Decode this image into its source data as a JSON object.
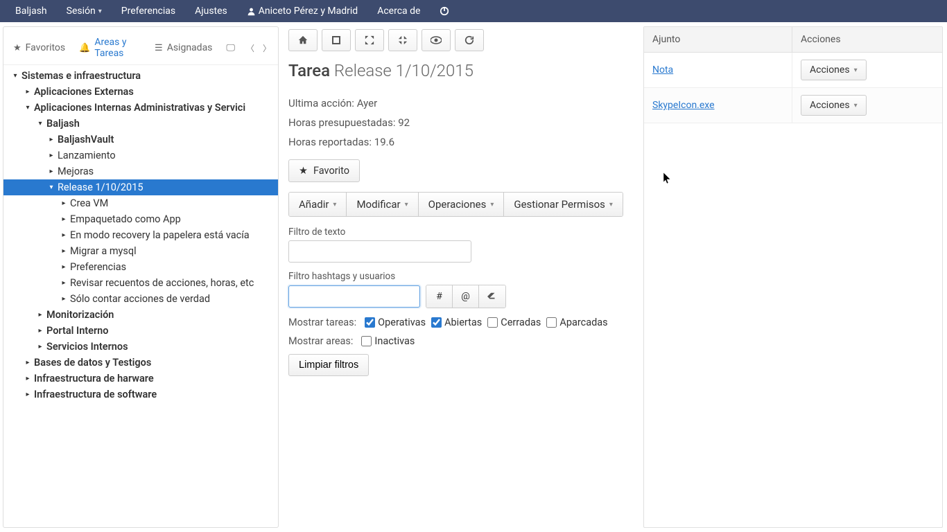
{
  "topbar": {
    "brand": "Baljash",
    "session": "Sesión",
    "prefs": "Preferencias",
    "settings": "Ajustes",
    "user": "Aniceto Pérez y Madrid",
    "about": "Acerca de"
  },
  "tabs": {
    "favoritos": "Favoritos",
    "areas": "Areas y Tareas",
    "asignadas": "Asignadas"
  },
  "tree": {
    "root": "Sistemas e infraestructura",
    "n1": "Aplicaciones Externas",
    "n2": "Aplicaciones Internas Administrativas y Servici",
    "n3": "Baljash",
    "n4": "BaljashVault",
    "n5": "Lanzamiento",
    "n6": "Mejoras",
    "n7": "Release 1/10/2015",
    "n8": "Crea VM",
    "n9": "Empaquetado como App",
    "n10": "En modo recovery la papelera está vacía",
    "n11": "Migrar a mysql",
    "n12": "Preferencias",
    "n13": "Revisar recuentos de acciones, horas, etc",
    "n14": "Sólo contar acciones de verdad",
    "n15": "Monitorización",
    "n16": "Portal Interno",
    "n17": "Servicios Internos",
    "n18": "Bases de datos y Testigos",
    "n19": "Infraestructura de harware",
    "n20": "Infraestructura de software"
  },
  "task": {
    "label": "Tarea",
    "name": "Release 1/10/2015",
    "last_action_label": "Ultima acción:",
    "last_action_value": "Ayer",
    "budget_label": "Horas presupuestadas:",
    "budget_value": "92",
    "reported_label": "Horas reportadas:",
    "reported_value": "19.6",
    "favorite": "Favorito"
  },
  "actions": {
    "add": "Añadir",
    "modify": "Modificar",
    "ops": "Operaciones",
    "perms": "Gestionar Permisos"
  },
  "filters": {
    "text_label": "Filtro de texto",
    "hash_label": "Filtro hashtags y usuarios",
    "show_tasks": "Mostrar tareas:",
    "show_areas": "Mostrar areas:",
    "operativas": "Operativas",
    "abiertas": "Abiertas",
    "cerradas": "Cerradas",
    "aparcadas": "Aparcadas",
    "inactivas": "Inactivas",
    "clear": "Limpiar filtros"
  },
  "attachments": {
    "col1": "Ajunto",
    "col2": "Acciones",
    "action_label": "Acciones",
    "rows": [
      {
        "name": "Nota"
      },
      {
        "name": "SkypeIcon.exe"
      }
    ]
  }
}
